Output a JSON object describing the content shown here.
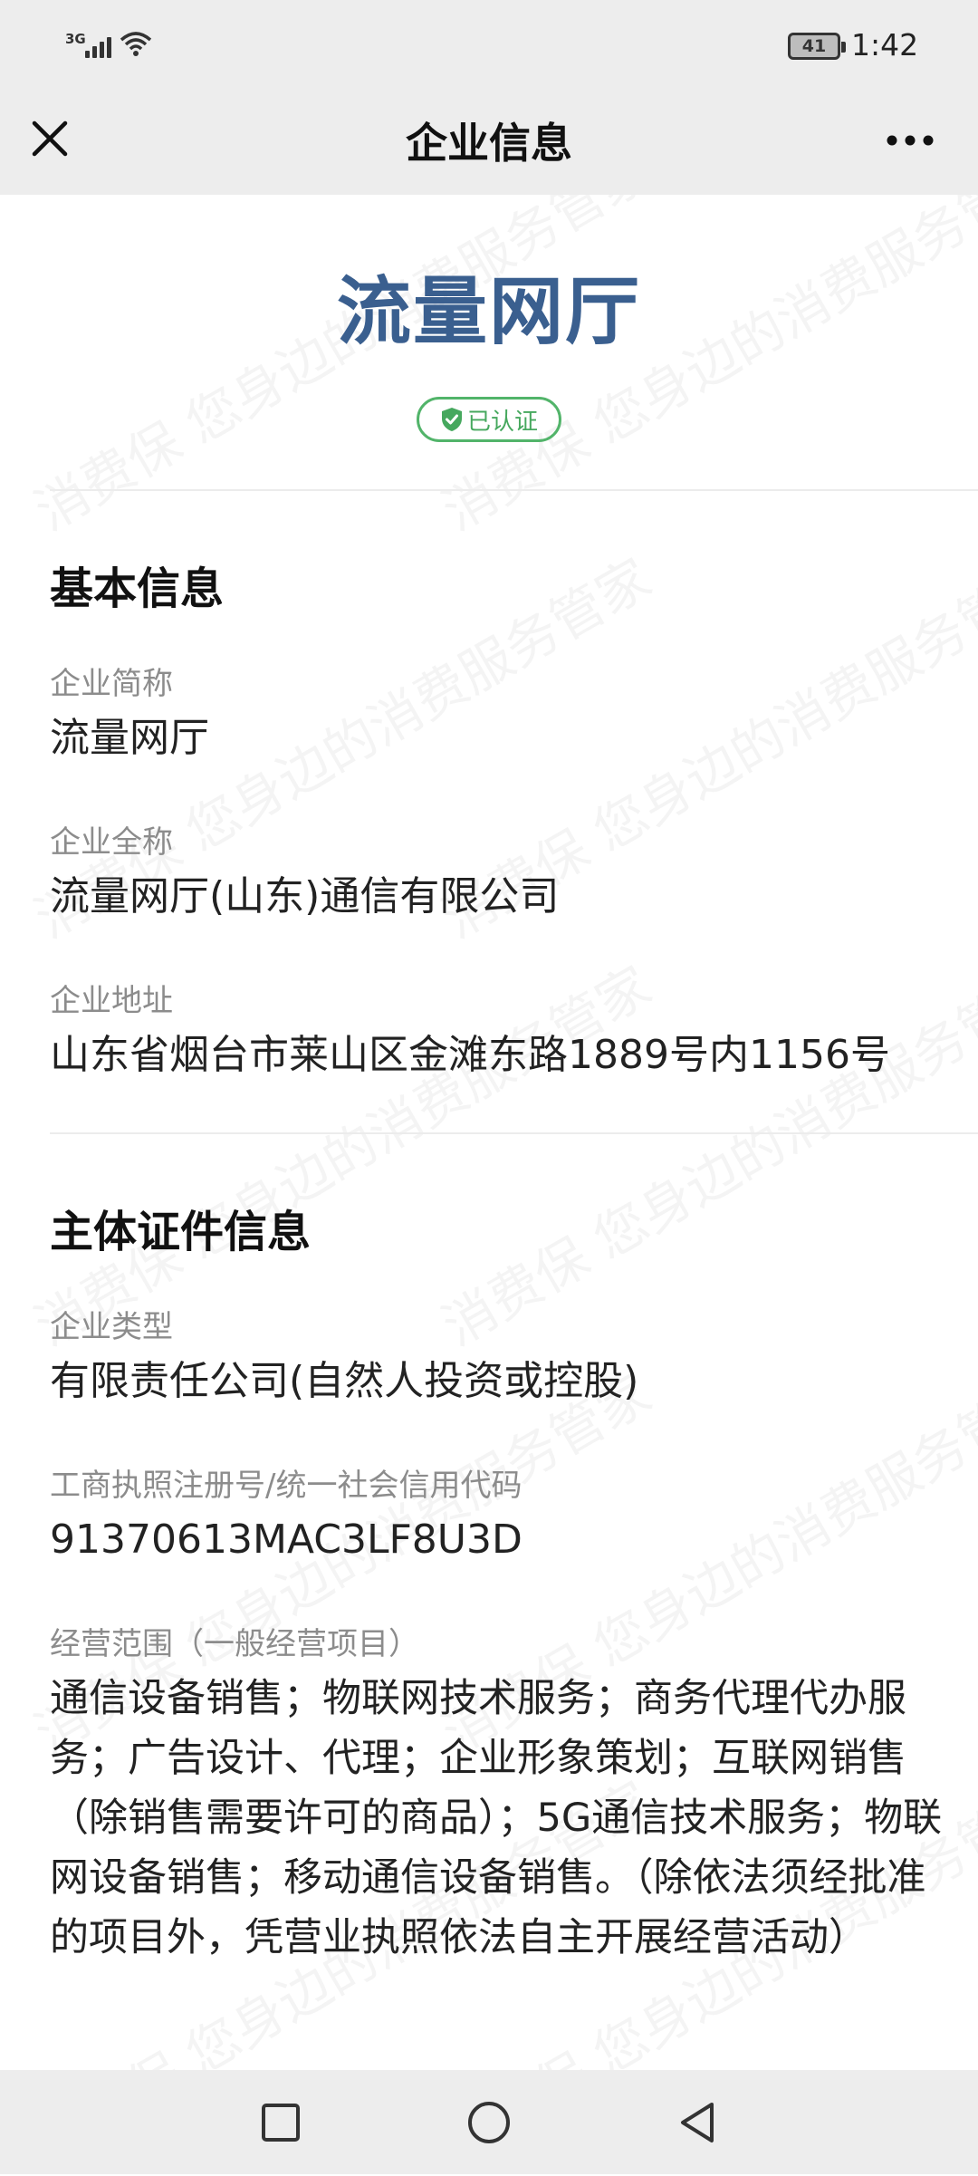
{
  "status_bar": {
    "network": "3G",
    "battery": "41",
    "time": "1:42"
  },
  "nav": {
    "title": "企业信息",
    "close_icon": "close-icon",
    "more_icon": "more-icon"
  },
  "header": {
    "company_name": "流量网厅",
    "badge": "已认证"
  },
  "basic_info": {
    "title": "基本信息",
    "fields": [
      {
        "label": "企业简称",
        "value": "流量网厅"
      },
      {
        "label": "企业全称",
        "value": "流量网厅(山东)通信有限公司"
      },
      {
        "label": "企业地址",
        "value": "山东省烟台市莱山区金滩东路1889号内1156号"
      }
    ]
  },
  "cert_info": {
    "title": "主体证件信息",
    "fields": [
      {
        "label": "企业类型",
        "value": "有限责任公司(自然人投资或控股)"
      },
      {
        "label": "工商执照注册号/统一社会信用代码",
        "value": "91370613MAC3LF8U3D"
      },
      {
        "label": "经营范围（一般经营项目）",
        "value": "通信设备销售；物联网技术服务；商务代理代办服务；广告设计、代理；企业形象策划；互联网销售（除销售需要许可的商品）；5G通信技术服务；物联网设备销售；移动通信设备销售。（除依法须经批准的项目外，凭营业执照依法自主开展经营活动）"
      }
    ]
  },
  "watermark": "消费保 您身边的消费服务管家",
  "colors": {
    "brand_blue": "#3a5f8f",
    "verified_green": "#52b46a",
    "bar_gray": "#ededed"
  }
}
